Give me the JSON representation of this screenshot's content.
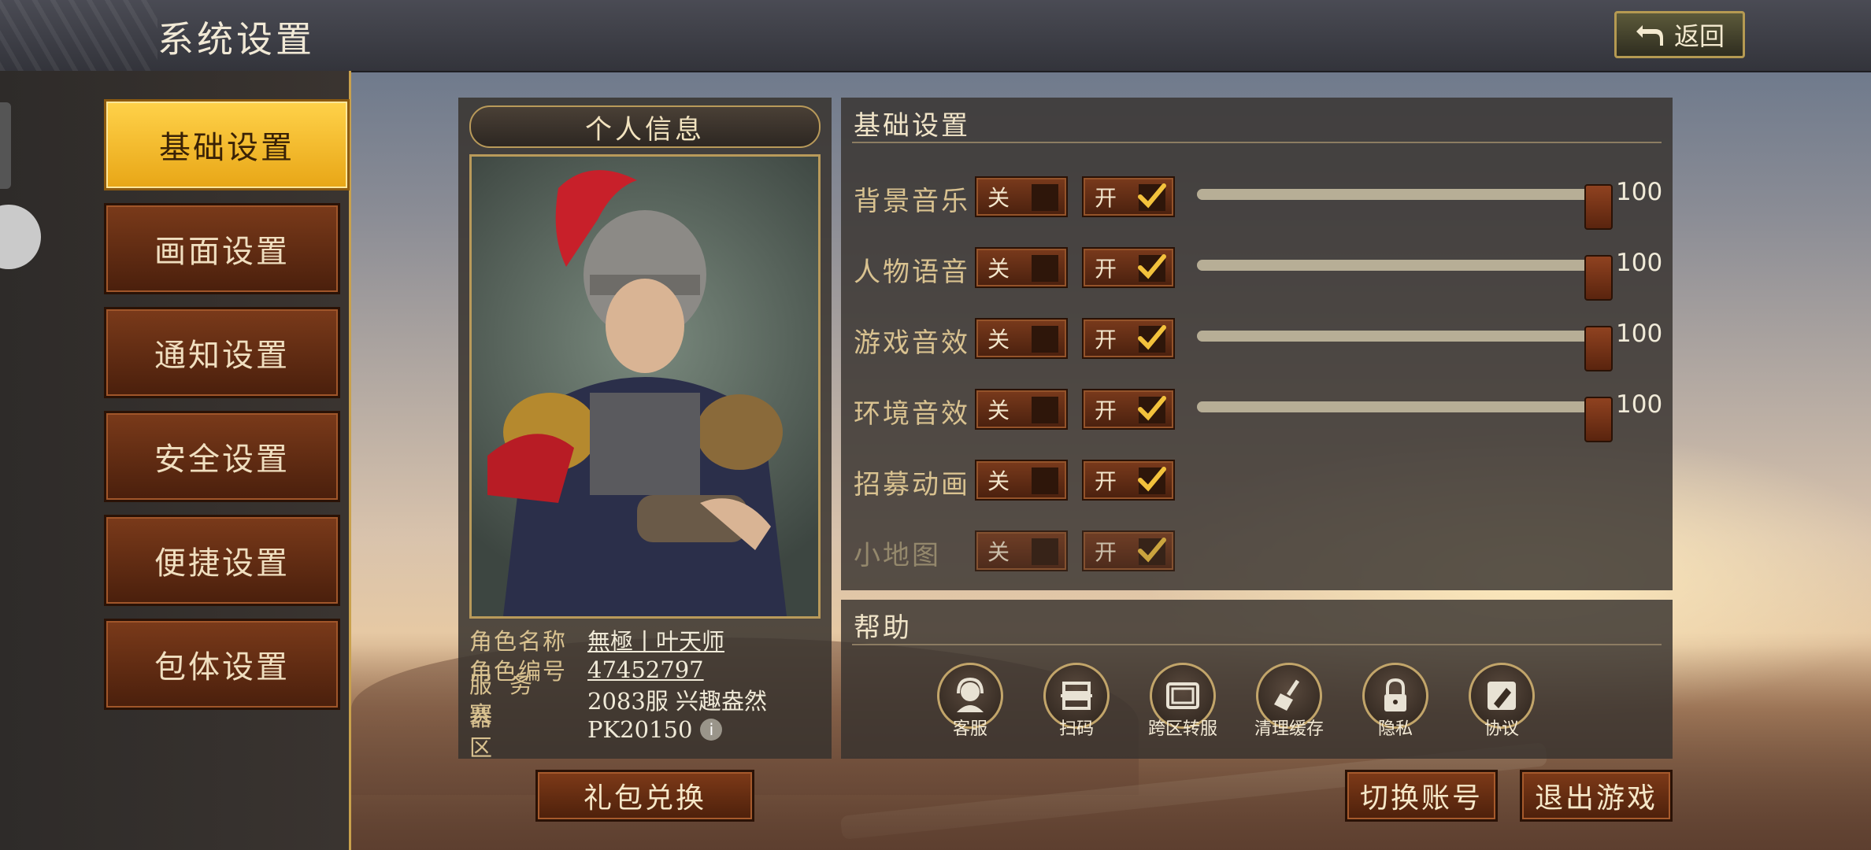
{
  "header": {
    "title": "系统设置",
    "back_label": "返回"
  },
  "sidebar": {
    "items": [
      {
        "label": "基础设置",
        "active": true
      },
      {
        "label": "画面设置"
      },
      {
        "label": "通知设置"
      },
      {
        "label": "安全设置"
      },
      {
        "label": "便捷设置"
      },
      {
        "label": "包体设置"
      }
    ]
  },
  "profile": {
    "header": "个人信息",
    "rows": [
      {
        "label": "角色名称",
        "value": "無極丨叶天师"
      },
      {
        "label": "角色编号",
        "value": "47452797"
      },
      {
        "label": "服务器",
        "value": "2083服 兴趣盎然"
      },
      {
        "label": "赛区",
        "value": "PK20150"
      }
    ]
  },
  "settings": {
    "title": "基础设置",
    "off_label": "关",
    "on_label": "开",
    "rows": [
      {
        "label": "背景音乐",
        "value": "100",
        "on": true
      },
      {
        "label": "人物语音",
        "value": "100",
        "on": true
      },
      {
        "label": "游戏音效",
        "value": "100",
        "on": true
      },
      {
        "label": "环境音效",
        "value": "100",
        "on": true
      },
      {
        "label": "招募动画",
        "on": true
      },
      {
        "label": "小地图",
        "on": true
      }
    ]
  },
  "help": {
    "title": "帮助",
    "items": [
      {
        "label": "客服",
        "icon": "customer-service-icon"
      },
      {
        "label": "扫码",
        "icon": "scan-icon"
      },
      {
        "label": "跨区转服",
        "icon": "transfer-icon"
      },
      {
        "label": "清理缓存",
        "icon": "broom-icon"
      },
      {
        "label": "隐私",
        "icon": "lock-icon"
      },
      {
        "label": "协议",
        "icon": "edit-icon"
      }
    ]
  },
  "buttons": {
    "gift": "礼包兑换",
    "switch_account": "切换账号",
    "exit_game": "退出游戏"
  },
  "colors": {
    "accent_gold": "#e8a616",
    "button_brown": "#7a3a1a"
  }
}
